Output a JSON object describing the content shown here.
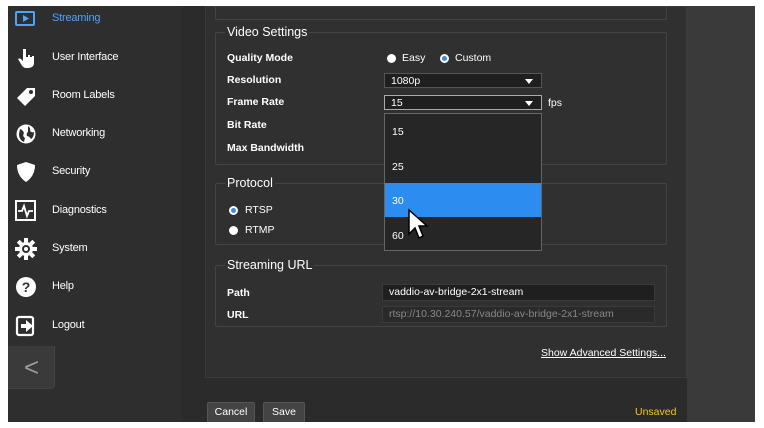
{
  "sidebar": {
    "items": [
      {
        "label": "Streaming",
        "icon": "streaming-icon",
        "active": true
      },
      {
        "label": "User Interface",
        "icon": "hand-pointer-icon"
      },
      {
        "label": "Room Labels",
        "icon": "tag-icon"
      },
      {
        "label": "Networking",
        "icon": "globe-icon"
      },
      {
        "label": "Security",
        "icon": "shield-icon"
      },
      {
        "label": "Diagnostics",
        "icon": "pulse-icon"
      },
      {
        "label": "System",
        "icon": "gear-icon"
      },
      {
        "label": "Help",
        "icon": "question-icon"
      },
      {
        "label": "Logout",
        "icon": "logout-icon"
      }
    ],
    "collapse_label": "<"
  },
  "video": {
    "title": "Video Settings",
    "quality_label": "Quality Mode",
    "quality_options": [
      "Easy",
      "Custom"
    ],
    "quality_selected": "Custom",
    "resolution_label": "Resolution",
    "resolution_value": "1080p",
    "frame_rate_label": "Frame Rate",
    "frame_rate_value": "15",
    "frame_rate_unit": "fps",
    "frame_rate_options": [
      "15",
      "25",
      "30",
      "60"
    ],
    "frame_rate_highlighted": "30",
    "bit_rate_label": "Bit Rate",
    "max_bandwidth_label": "Max Bandwidth"
  },
  "protocol": {
    "title": "Protocol",
    "options": [
      "RTSP",
      "RTMP"
    ],
    "selected": "RTSP"
  },
  "streaming_url": {
    "title": "Streaming URL",
    "path_label": "Path",
    "path_value": "vaddio-av-bridge-2x1-stream",
    "url_label": "URL",
    "url_value": "rtsp://10.30.240.57/vaddio-av-bridge-2x1-stream"
  },
  "advanced_link": "Show Advanced Settings...",
  "footer": {
    "cancel": "Cancel",
    "save": "Save",
    "status": "Unsaved"
  },
  "colors": {
    "accent": "#3a8dde",
    "highlight": "#2d8cf0",
    "unsaved": "#f5c518",
    "active_nav": "#4aa3ff"
  }
}
